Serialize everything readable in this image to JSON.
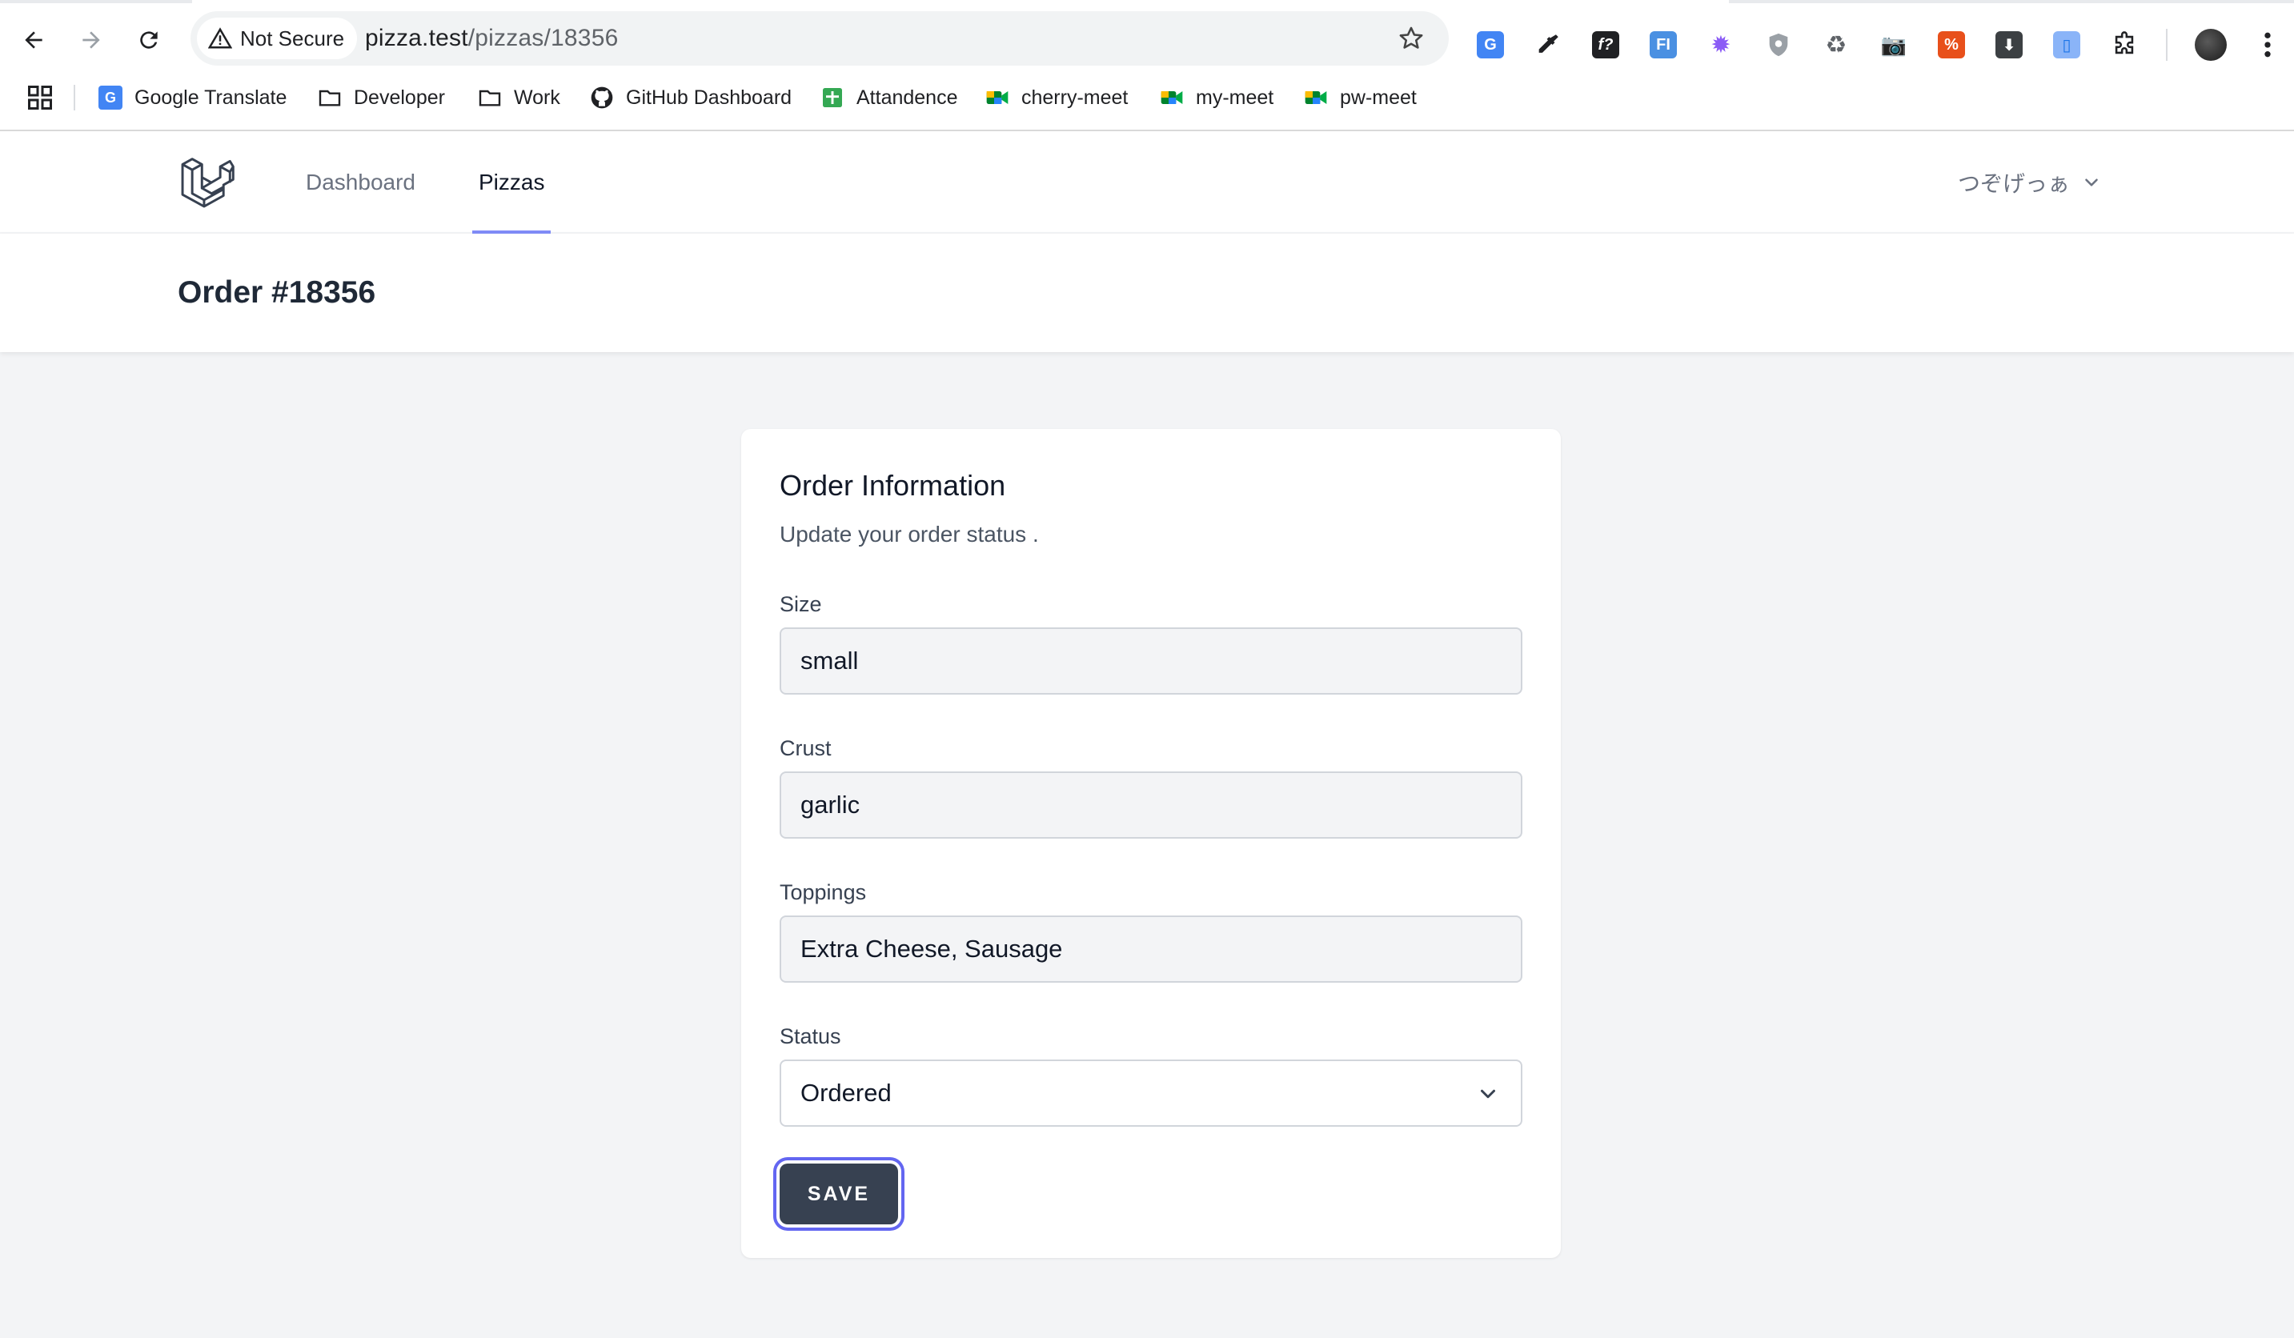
{
  "browser": {
    "security_label": "Not Secure",
    "url_host": "pizza.test",
    "url_path": "/pizzas/18356",
    "bookmarks": [
      {
        "label": "Google Translate",
        "icon": "google-translate-icon"
      },
      {
        "label": "Developer",
        "icon": "folder-icon"
      },
      {
        "label": "Work",
        "icon": "folder-icon"
      },
      {
        "label": "GitHub Dashboard",
        "icon": "github-icon"
      },
      {
        "label": "Attandence",
        "icon": "sheets-icon"
      },
      {
        "label": "cherry-meet",
        "icon": "google-meet-icon"
      },
      {
        "label": "my-meet",
        "icon": "google-meet-icon"
      },
      {
        "label": "pw-meet",
        "icon": "google-meet-icon"
      }
    ]
  },
  "app": {
    "nav": {
      "dashboard_label": "Dashboard",
      "pizzas_label": "Pizzas",
      "user_name": "つぞげっぁ"
    },
    "page_title": "Order #18356"
  },
  "form": {
    "title": "Order Information",
    "subtitle": "Update your order status .",
    "size_label": "Size",
    "size_value": "small",
    "crust_label": "Crust",
    "crust_value": "garlic",
    "toppings_label": "Toppings",
    "toppings_value": "Extra Cheese, Sausage",
    "status_label": "Status",
    "status_value": "Ordered",
    "save_label": "SAVE"
  },
  "colors": {
    "accent": "#818cf8",
    "button": "#374151",
    "focus_ring": "#6366f1",
    "background": "#f3f4f6"
  }
}
